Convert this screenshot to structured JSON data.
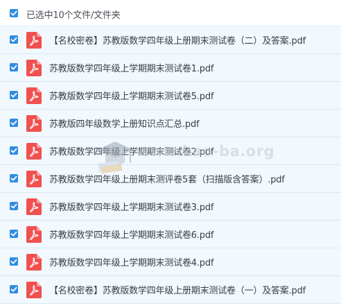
{
  "header": {
    "selection_label": "已选中10个文件/文件夹",
    "checked": true
  },
  "files": [
    {
      "name": "【名校密卷】苏教版数学四年级上册期末测试卷（二）及答案.pdf",
      "checked": true,
      "icon": "pdf-icon"
    },
    {
      "name": "苏教版数学四年级上学期期末测试卷1.pdf",
      "checked": true,
      "icon": "pdf-icon"
    },
    {
      "name": "苏教版数学四年级上学期期末测试卷5.pdf",
      "checked": true,
      "icon": "pdf-icon"
    },
    {
      "name": "苏教版四年级数学上册知识点汇总.pdf",
      "checked": true,
      "icon": "pdf-icon"
    },
    {
      "name": "苏教版数学四年级上学期期末测试卷2.pdf",
      "checked": true,
      "icon": "pdf-icon"
    },
    {
      "name": "苏教版数学四年级上册期末测评卷5套（扫描版含答案）.pdf",
      "checked": true,
      "icon": "pdf-icon"
    },
    {
      "name": "苏教版数学四年级上学期期末测试卷3.pdf",
      "checked": true,
      "icon": "pdf-icon"
    },
    {
      "name": "苏教版数学四年级上学期期末测试卷6.pdf",
      "checked": true,
      "icon": "pdf-icon"
    },
    {
      "name": "苏教版数学四年级上学期期末测试卷4.pdf",
      "checked": true,
      "icon": "pdf-icon"
    },
    {
      "name": "【名校密卷】苏教版数学四年级上册期末测试卷（一）及答案.pdf",
      "checked": true,
      "icon": "pdf-icon"
    }
  ],
  "watermark": {
    "text": "www.kao-ba.org"
  },
  "colors": {
    "checkbox": "#2f8ce0",
    "pdf_icon": "#f0504f",
    "row_background": "#f1f8fe",
    "row_border": "#d9e8f6"
  }
}
